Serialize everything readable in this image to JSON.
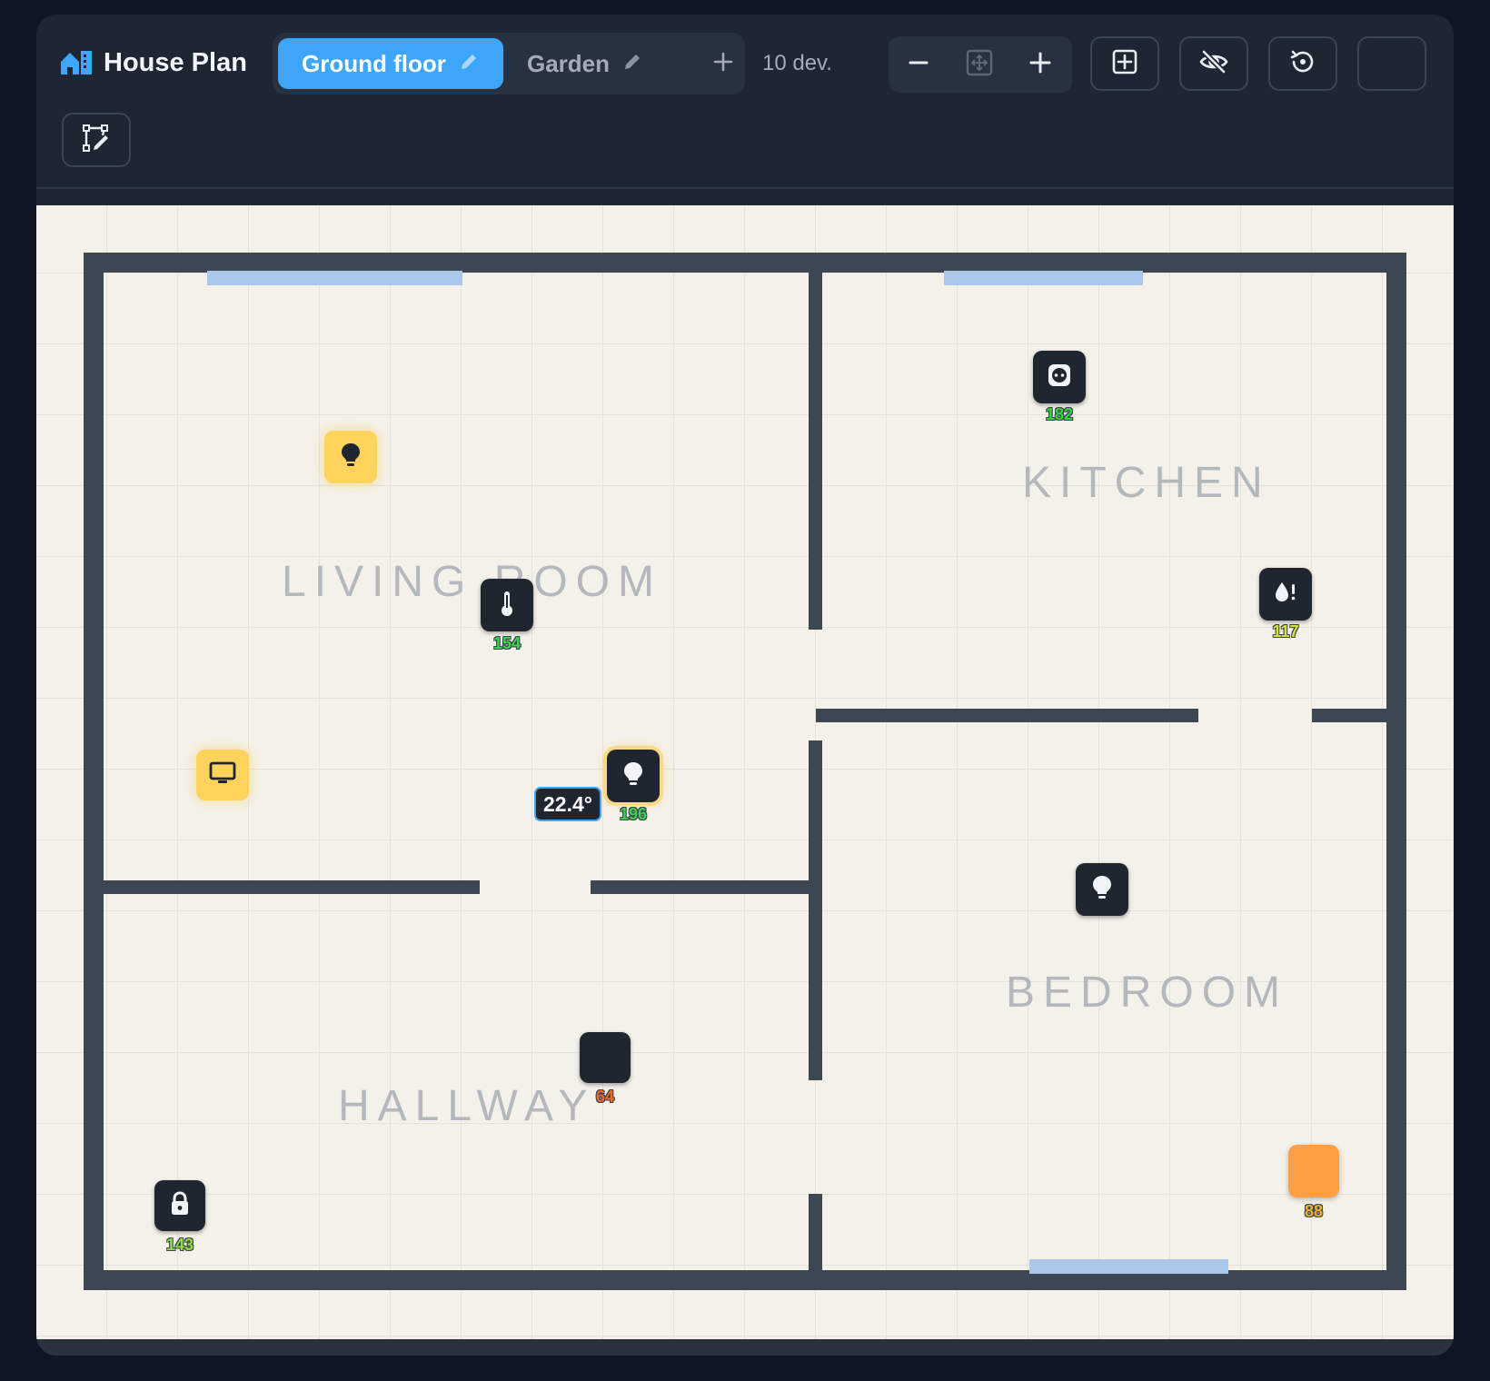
{
  "header": {
    "title": "House Plan",
    "tabs": [
      {
        "label": "Ground floor",
        "active": true
      },
      {
        "label": "Garden",
        "active": false
      }
    ],
    "device_count": "10 dev."
  },
  "rooms": [
    {
      "name": "LIVING ROOM"
    },
    {
      "name": "KITCHEN"
    },
    {
      "name": "HALLWAY"
    },
    {
      "name": "BEDROOM"
    }
  ],
  "devices": {
    "kitchen_socket": {
      "icon": "socket-icon",
      "value": "182",
      "value_color": "#37d636"
    },
    "living_lamp": {
      "icon": "lightbulb-icon",
      "state": "on"
    },
    "thermometer": {
      "icon": "thermometer-icon",
      "value": "154",
      "value_color": "#3fd34b",
      "reading": "22.4°"
    },
    "water_sensor": {
      "icon": "water-leak-icon",
      "value": "117",
      "value_color": "#d9e23a"
    },
    "tv": {
      "icon": "tv-icon",
      "state": "on"
    },
    "center_lamp": {
      "icon": "lightbulb-icon",
      "value": "196",
      "value_color": "#3fd34b"
    },
    "bedroom_lamp": {
      "icon": "lightbulb-icon"
    },
    "hallway_device": {
      "value": "64",
      "value_color": "#f06a2a"
    },
    "door_lock": {
      "icon": "lock-icon",
      "value": "143",
      "value_color": "#8ee03a"
    },
    "bedroom_orange": {
      "value": "88",
      "value_color": "#f0b429"
    }
  },
  "colors": {
    "accent": "#3ea6f9",
    "wall": "#3d4753",
    "window": "#a9c8ea",
    "canvas": "#f4f1ea",
    "device_on": "#fdd35c"
  }
}
